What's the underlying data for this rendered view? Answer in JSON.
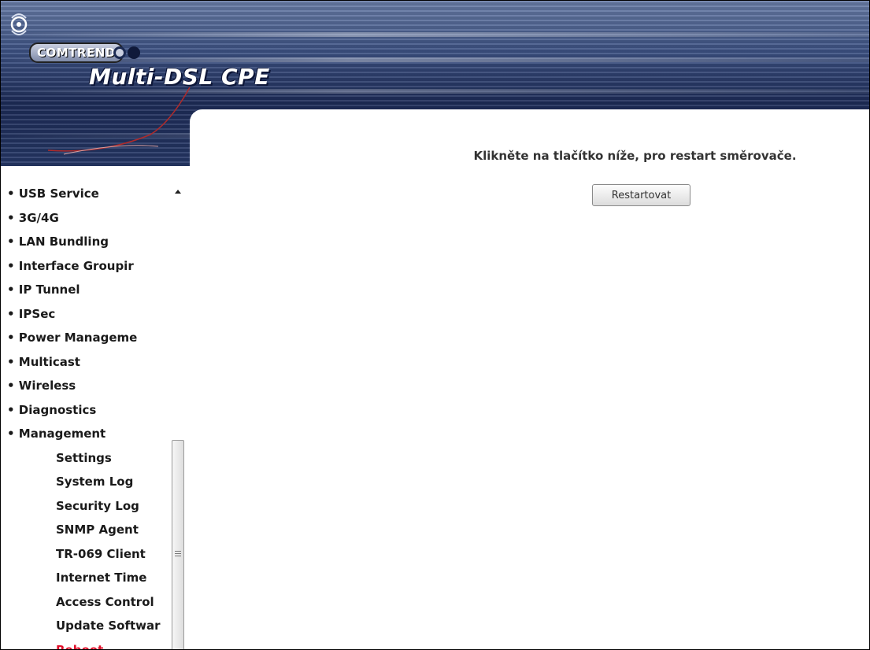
{
  "header": {
    "brand": "COMTREND",
    "product": "Multi-DSL CPE"
  },
  "sidebar": {
    "items": [
      {
        "label": "• USB Service"
      },
      {
        "label": "• 3G/4G"
      },
      {
        "label": "• LAN Bundling"
      },
      {
        "label": "• Interface Groupir"
      },
      {
        "label": "• IP Tunnel"
      },
      {
        "label": "• IPSec"
      },
      {
        "label": "• Power Manageme"
      },
      {
        "label": "• Multicast"
      },
      {
        "label": "• Wireless"
      },
      {
        "label": "• Diagnostics"
      },
      {
        "label": "• Management"
      }
    ],
    "subitems": [
      {
        "label": "Settings"
      },
      {
        "label": "System Log"
      },
      {
        "label": "Security Log"
      },
      {
        "label": "SNMP Agent"
      },
      {
        "label": "TR-069 Client"
      },
      {
        "label": "Internet Time"
      },
      {
        "label": "Access Control"
      },
      {
        "label": "Update Softwar"
      },
      {
        "label": "Reboot",
        "active": true
      }
    ]
  },
  "main": {
    "message": "Klikněte na tlačítko níže, pro restart směrovače.",
    "button_label": "Restartovat"
  },
  "colors": {
    "active_menu": "#e0102a",
    "header_dark": "#1d2c58"
  }
}
